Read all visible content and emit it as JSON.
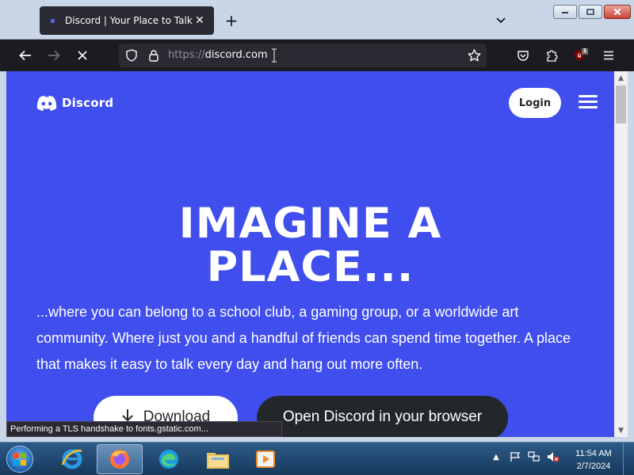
{
  "browser": {
    "tab_title": "Discord | Your Place to Talk and",
    "url_scheme": "https://",
    "url_host": "discord.com",
    "new_tab_label": "+",
    "tab_close_label": "✕"
  },
  "page": {
    "logo_text": "Discord",
    "login_label": "Login",
    "hero_line1": "IMAGINE A",
    "hero_line2": "PLACE...",
    "hero_text": "...where you can belong to a school club, a gaming group, or a worldwide art community. Where just you and a handful of friends can spend time together. A place that makes it easy to talk every day and hang out more often.",
    "download_label": "Download",
    "browser_button_label": "Open Discord in your browser",
    "accent_color": "#404eed"
  },
  "status_text": "Performing a TLS handshake to fonts.gstatic.com...",
  "extension_badge": "1",
  "taskbar": {
    "time": "11:54 AM",
    "date": "2/7/2024"
  }
}
